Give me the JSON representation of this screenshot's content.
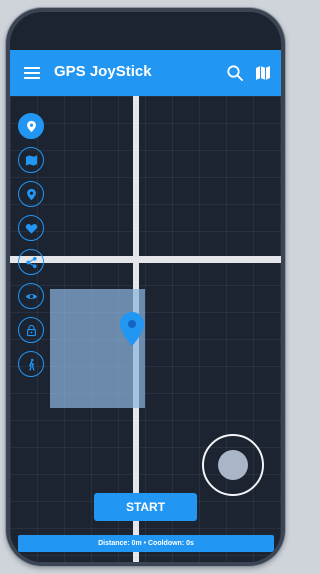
{
  "app": {
    "title": "GPS JoyStick"
  },
  "appbar": {
    "menu_icon": "menu-icon",
    "actions": [
      {
        "icon": "search-icon"
      },
      {
        "icon": "map-icon"
      }
    ]
  },
  "sidebar": {
    "items": [
      {
        "icon": "location-pin-icon",
        "active": true
      },
      {
        "icon": "map-icon",
        "active": false
      },
      {
        "icon": "location-pin-icon",
        "active": false
      },
      {
        "icon": "heart-icon",
        "active": false
      },
      {
        "icon": "share-icon",
        "active": false
      },
      {
        "icon": "eye-icon",
        "active": false
      },
      {
        "icon": "lock-icon",
        "active": false
      },
      {
        "icon": "walk-icon",
        "active": false
      }
    ]
  },
  "controls": {
    "start_label": "START"
  },
  "status": {
    "text": "Distance: 0m • Cooldown: 0s"
  },
  "colors": {
    "accent": "#2196f3",
    "map_background": "#1c2331",
    "road": "#e4e6ea",
    "area": "#8cb4dc",
    "joystick_knob": "#aab6c8"
  }
}
